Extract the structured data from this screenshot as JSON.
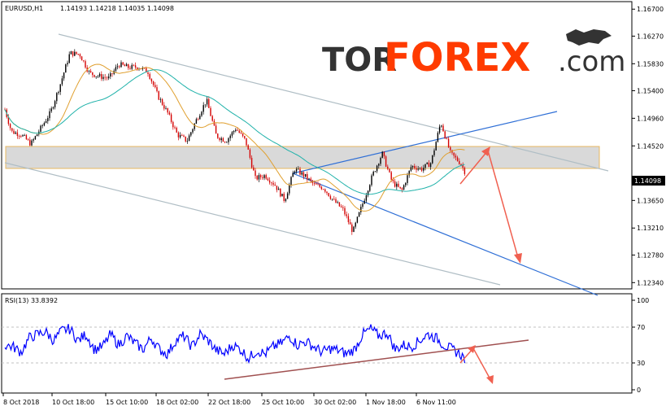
{
  "header": {
    "symbol": "EURUSD,H1",
    "ohlc": "1.14193 1.14218 1.14035 1.14098"
  },
  "logo": {
    "tor": "TOR",
    "forex": "FOREX",
    "com": ".com",
    "tor_color": "#333333",
    "forex_color": "#ff3b00",
    "com_color": "#333333"
  },
  "rsi_panel": {
    "label": "RSI(13) 33.8392"
  },
  "colors": {
    "candle_up": "#000000",
    "candle_down": "#d40000",
    "ma_fast": "#e0a030",
    "ma_slow": "#20b2aa",
    "channel": "#b0bec5",
    "blue_line": "#2f6fd6",
    "arrow": "#f06050",
    "zone_fill": "#d9d9d9",
    "zone_border": "#e8b860",
    "rsi_line": "#0000ff",
    "rsi_trend": "#a05050",
    "price_tag_bg": "#000000",
    "price_tag_text": "#ffffff"
  },
  "chart_data": [
    {
      "type": "candlestick",
      "title": "EURUSD,H1",
      "price_axis_ticks": [
        "1.16700",
        "1.16270",
        "1.15830",
        "1.15400",
        "1.14960",
        "1.14520",
        "1.14098",
        "1.13650",
        "1.13210",
        "1.12780",
        "1.12340"
      ],
      "time_axis_ticks": [
        "8 Oct 2018",
        "10 Oct 18:00",
        "15 Oct 10:00",
        "18 Oct 02:00",
        "22 Oct 18:00",
        "25 Oct 10:00",
        "30 Oct 02:00",
        "1 Nov 18:00",
        "6 Nov 11:00"
      ],
      "last_price": "1.14098",
      "ylim": [
        1.1224,
        1.1682
      ],
      "series_close_anchor": [
        [
          0,
          1.151
        ],
        [
          8,
          1.1475
        ],
        [
          20,
          1.147
        ],
        [
          32,
          1.1455
        ],
        [
          44,
          1.148
        ],
        [
          56,
          1.1505
        ],
        [
          68,
          1.155
        ],
        [
          80,
          1.16
        ],
        [
          92,
          1.1598
        ],
        [
          104,
          1.1568
        ],
        [
          116,
          1.1563
        ],
        [
          128,
          1.156
        ],
        [
          140,
          1.1582
        ],
        [
          152,
          1.1577
        ],
        [
          164,
          1.1578
        ],
        [
          176,
          1.157
        ],
        [
          188,
          1.1532
        ],
        [
          200,
          1.1505
        ],
        [
          212,
          1.147
        ],
        [
          224,
          1.146
        ],
        [
          236,
          1.1495
        ],
        [
          248,
          1.1525
        ],
        [
          260,
          1.1468
        ],
        [
          272,
          1.146
        ],
        [
          284,
          1.148
        ],
        [
          296,
          1.146
        ],
        [
          308,
          1.14
        ],
        [
          320,
          1.1405
        ],
        [
          332,
          1.139
        ],
        [
          344,
          1.1365
        ],
        [
          356,
          1.1415
        ],
        [
          368,
          1.1405
        ],
        [
          380,
          1.139
        ],
        [
          392,
          1.1385
        ],
        [
          404,
          1.1365
        ],
        [
          416,
          1.135
        ],
        [
          428,
          1.1315
        ],
        [
          440,
          1.136
        ],
        [
          452,
          1.1405
        ],
        [
          464,
          1.144
        ],
        [
          476,
          1.1395
        ],
        [
          488,
          1.138
        ],
        [
          500,
          1.142
        ],
        [
          512,
          1.1415
        ],
        [
          524,
          1.1425
        ],
        [
          536,
          1.149
        ],
        [
          548,
          1.144
        ],
        [
          560,
          1.1425
        ],
        [
          566,
          1.141
        ]
      ],
      "support_resistance_zone": [
        1.1435,
        1.1468
      ],
      "rsi": {
        "ylim": [
          0,
          100
        ],
        "ticks": [
          "100",
          "70",
          "30",
          "0"
        ],
        "last_value": 33.8392,
        "anchor": [
          [
            0,
            50
          ],
          [
            10,
            48
          ],
          [
            20,
            42
          ],
          [
            30,
            58
          ],
          [
            40,
            62
          ],
          [
            50,
            65
          ],
          [
            60,
            55
          ],
          [
            70,
            66
          ],
          [
            80,
            68
          ],
          [
            90,
            55
          ],
          [
            100,
            62
          ],
          [
            110,
            45
          ],
          [
            120,
            48
          ],
          [
            130,
            62
          ],
          [
            140,
            50
          ],
          [
            150,
            60
          ],
          [
            160,
            52
          ],
          [
            170,
            45
          ],
          [
            180,
            58
          ],
          [
            190,
            45
          ],
          [
            200,
            40
          ],
          [
            210,
            55
          ],
          [
            220,
            60
          ],
          [
            230,
            48
          ],
          [
            240,
            62
          ],
          [
            250,
            55
          ],
          [
            260,
            44
          ],
          [
            270,
            40
          ],
          [
            280,
            50
          ],
          [
            290,
            45
          ],
          [
            300,
            35
          ],
          [
            310,
            44
          ],
          [
            320,
            40
          ],
          [
            330,
            48
          ],
          [
            340,
            52
          ],
          [
            350,
            60
          ],
          [
            360,
            50
          ],
          [
            370,
            54
          ],
          [
            380,
            48
          ],
          [
            390,
            42
          ],
          [
            400,
            46
          ],
          [
            410,
            44
          ],
          [
            420,
            40
          ],
          [
            430,
            45
          ],
          [
            440,
            62
          ],
          [
            450,
            68
          ],
          [
            460,
            60
          ],
          [
            470,
            64
          ],
          [
            480,
            45
          ],
          [
            490,
            50
          ],
          [
            500,
            48
          ],
          [
            510,
            55
          ],
          [
            520,
            62
          ],
          [
            530,
            58
          ],
          [
            540,
            50
          ],
          [
            550,
            45
          ],
          [
            560,
            40
          ],
          [
            566,
            34
          ]
        ]
      }
    }
  ]
}
